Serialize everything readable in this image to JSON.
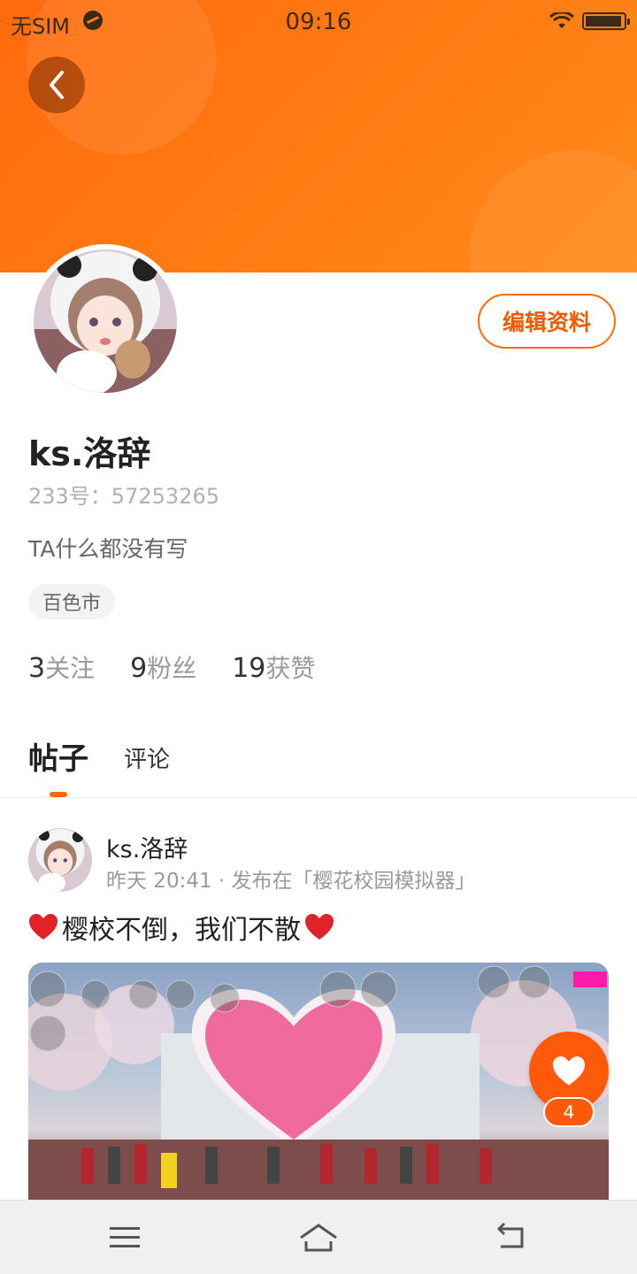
{
  "status_bar": {
    "carrier": "无SIM",
    "time": "09:16"
  },
  "colors": {
    "accent": "#ff6a00",
    "banner": "#ff7a12"
  },
  "profile": {
    "username": "ks.洛辞",
    "uid": "233号：57253265",
    "bio": "TA什么都没有写",
    "city": "百色市",
    "edit_label": "编辑资料",
    "stats": [
      {
        "num": "3",
        "label": "关注"
      },
      {
        "num": "9",
        "label": "粉丝"
      },
      {
        "num": "19",
        "label": "获赞"
      }
    ]
  },
  "tabs": [
    {
      "label": "帖子",
      "active": true
    },
    {
      "label": "评论",
      "active": false
    }
  ],
  "post": {
    "author": "ks.洛辞",
    "meta": "昨天 20:41 · 发布在「樱花校园模拟器」",
    "text": "樱校不倒，我们不散",
    "like_count": "4"
  },
  "icons": [
    "back-arrow-icon",
    "heart-icon",
    "menu-icon",
    "home-icon",
    "back-icon",
    "wifi-icon",
    "battery-icon"
  ]
}
